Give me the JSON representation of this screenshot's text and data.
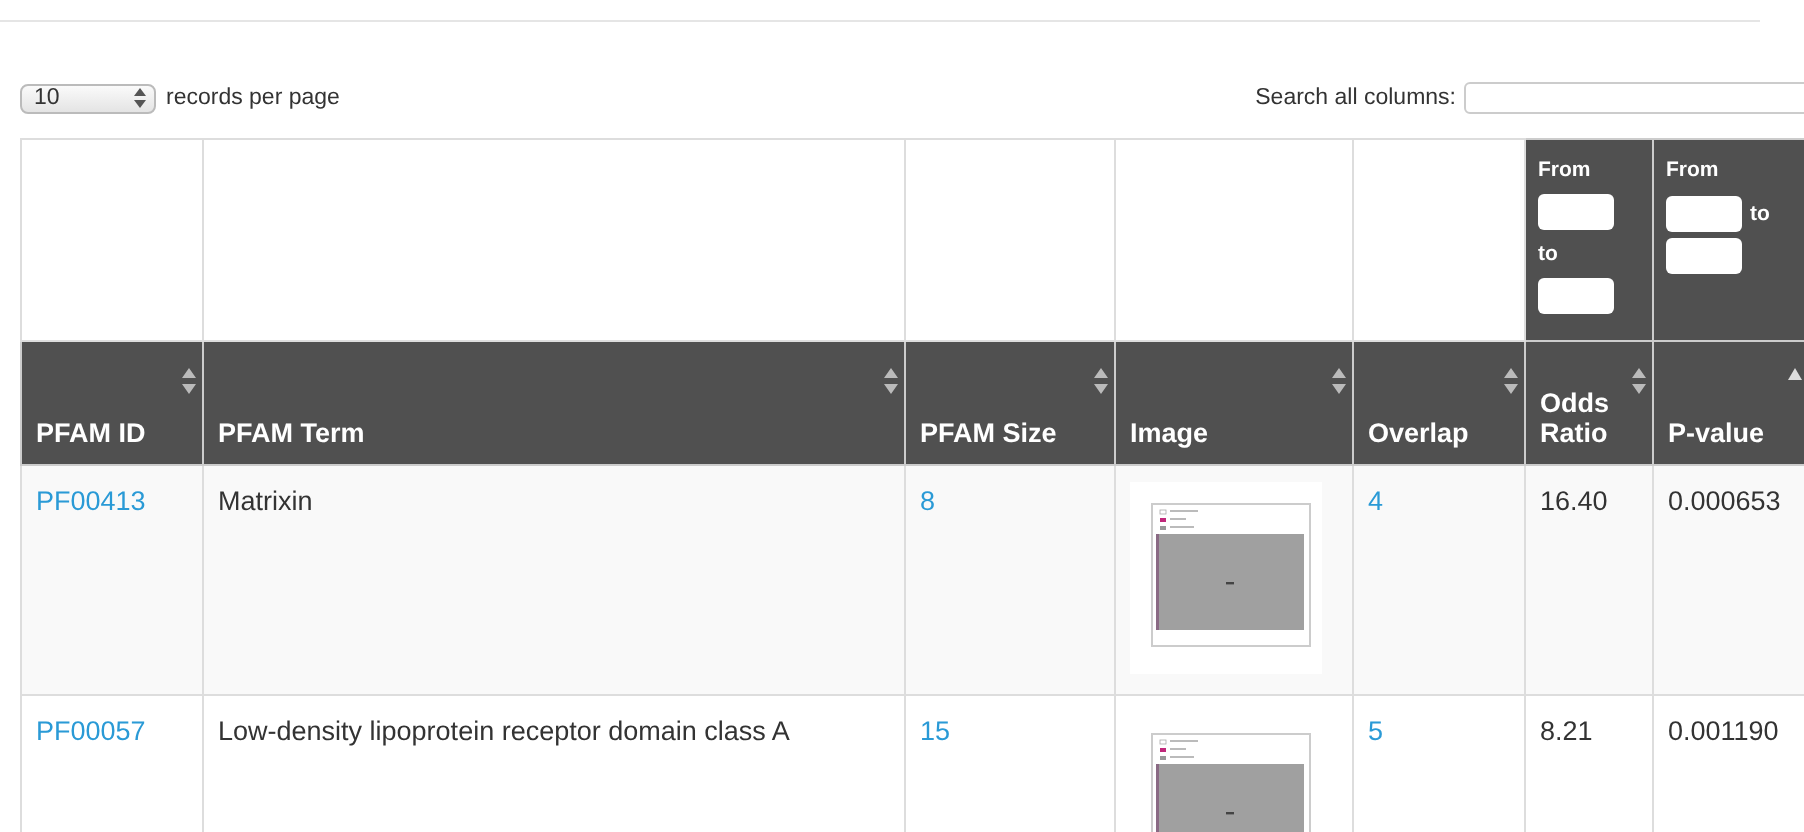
{
  "length_menu": {
    "value": "10",
    "label": "records per page"
  },
  "search": {
    "label": "Search all columns:"
  },
  "table": {
    "columns": [
      {
        "label": "PFAM ID",
        "sorted": false
      },
      {
        "label": "PFAM Term",
        "sorted": false
      },
      {
        "label": "PFAM Size",
        "sorted": false
      },
      {
        "label": "Image",
        "sorted": false
      },
      {
        "label": "Overlap",
        "sorted": false
      },
      {
        "label": "Odds Ratio",
        "sorted": false,
        "filter": {
          "from": "From",
          "to": "to"
        }
      },
      {
        "label": "P-value",
        "sorted": true,
        "filter": {
          "from": "From",
          "to": "to"
        }
      }
    ],
    "rows": [
      {
        "id": "PF00413",
        "term": "Matrixin",
        "size": "8",
        "image": {
          "kind": "plot"
        },
        "overlap": "4",
        "odds_ratio": "16.40",
        "p_value": "0.000653"
      },
      {
        "id": "PF00057",
        "term": "Low-density lipoprotein receptor domain class A",
        "size": "15",
        "image": {
          "kind": "plot"
        },
        "overlap": "5",
        "odds_ratio": "8.21",
        "p_value": "0.001190"
      }
    ]
  }
}
